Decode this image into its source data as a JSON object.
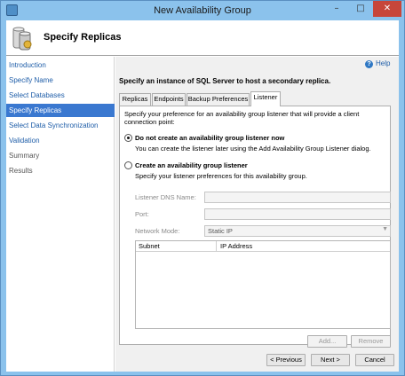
{
  "window": {
    "title": "New Availability Group",
    "minimize_glyph": "–",
    "maximize_glyph": "□",
    "close_glyph": "✕"
  },
  "header": {
    "title": "Specify Replicas",
    "icon": "wizard-page-icon"
  },
  "nav": {
    "items": [
      {
        "label": "Introduction",
        "state": "link"
      },
      {
        "label": "Specify Name",
        "state": "link"
      },
      {
        "label": "Select Databases",
        "state": "link"
      },
      {
        "label": "Specify Replicas",
        "state": "active"
      },
      {
        "label": "Select Data Synchronization",
        "state": "link"
      },
      {
        "label": "Validation",
        "state": "link"
      },
      {
        "label": "Summary",
        "state": "disabled"
      },
      {
        "label": "Results",
        "state": "disabled"
      }
    ]
  },
  "main": {
    "help_label": "Help",
    "instruction": "Specify an instance of SQL Server to host a secondary replica.",
    "tabs": [
      "Replicas",
      "Endpoints",
      "Backup Preferences",
      "Listener"
    ],
    "active_tab": "Listener",
    "listener": {
      "intro_line1": "Specify your preference for an availability group listener that will provide a client",
      "intro_line2": "connection point:",
      "option1": {
        "label": "Do not create an availability group listener now",
        "description": "You can create the listener later using the Add Availability Group Listener dialog.",
        "selected": true
      },
      "option2": {
        "label": "Create an availability group listener",
        "description": "Specify your listener preferences for this availability group.",
        "selected": false
      },
      "dns_label": "Listener DNS Name:",
      "dns_value": "",
      "port_label": "Port:",
      "port_value": "",
      "network_mode_label": "Network Mode:",
      "network_mode_value": "Static IP",
      "grid_columns": [
        "Subnet",
        "IP Address"
      ],
      "add_button": "Add...",
      "remove_button": "Remove"
    }
  },
  "footer": {
    "previous": "< Previous",
    "next": "Next >",
    "cancel": "Cancel"
  },
  "colors": {
    "window_frame": "#8bc2ec",
    "nav_active": "#3a78d0",
    "link": "#1e5da8",
    "close_button": "#c7463a"
  }
}
